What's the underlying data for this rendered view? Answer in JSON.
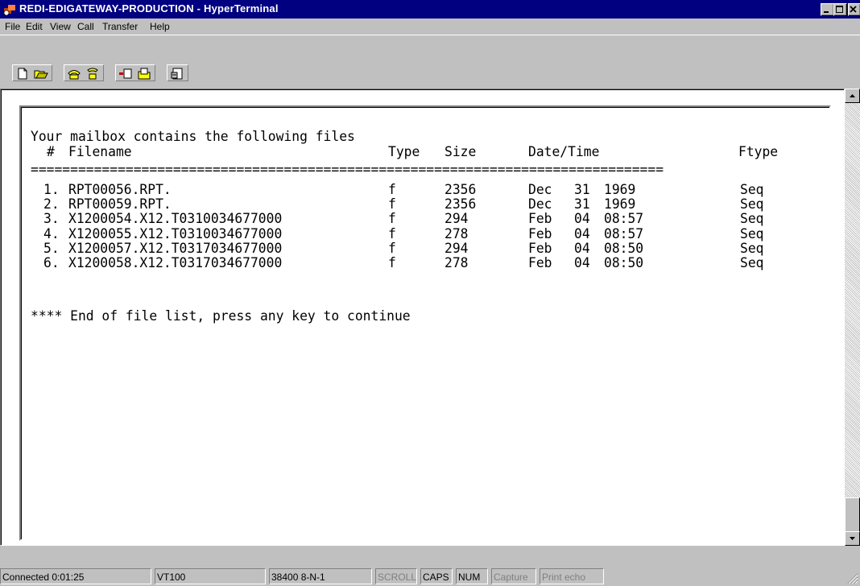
{
  "window": {
    "title": "REDI-EDIGATEWAY-PRODUCTION - HyperTerminal"
  },
  "menu": [
    "File",
    "Edit",
    "View",
    "Call",
    "Transfer",
    "Help"
  ],
  "toolbar": {
    "buttons": [
      "new-icon",
      "open-icon",
      "call-icon",
      "disconnect-icon",
      "send-icon",
      "receive-icon",
      "properties-icon"
    ]
  },
  "terminal": {
    "intro": "Your mailbox contains the following files",
    "header": {
      "num": "#",
      "filename": "Filename",
      "type": "Type",
      "size": "Size",
      "datetime": "Date/Time",
      "ftype": "Ftype"
    },
    "separator": "================================================================================",
    "files": [
      {
        "num": "1.",
        "name": "RPT00056.RPT.",
        "type": "f",
        "size": "2356",
        "mon": "Dec",
        "day": "31",
        "time": "1969",
        "ftype": "Seq"
      },
      {
        "num": "2.",
        "name": "RPT00059.RPT.",
        "type": "f",
        "size": "2356",
        "mon": "Dec",
        "day": "31",
        "time": "1969",
        "ftype": "Seq"
      },
      {
        "num": "3.",
        "name": "X1200054.X12.T0310034677000",
        "type": "f",
        "size": "294",
        "mon": "Feb",
        "day": "04",
        "time": "08:57",
        "ftype": "Seq"
      },
      {
        "num": "4.",
        "name": "X1200055.X12.T0310034677000",
        "type": "f",
        "size": "278",
        "mon": "Feb",
        "day": "04",
        "time": "08:57",
        "ftype": "Seq"
      },
      {
        "num": "5.",
        "name": "X1200057.X12.T0317034677000",
        "type": "f",
        "size": "294",
        "mon": "Feb",
        "day": "04",
        "time": "08:50",
        "ftype": "Seq"
      },
      {
        "num": "6.",
        "name": "X1200058.X12.T0317034677000",
        "type": "f",
        "size": "278",
        "mon": "Feb",
        "day": "04",
        "time": "08:50",
        "ftype": "Seq"
      }
    ],
    "footer": "**** End of file list, press any key to continue"
  },
  "status": {
    "connected": "Connected 0:01:25",
    "emulation": "VT100",
    "port": "38400 8-N-1",
    "scroll": "SCROLL",
    "caps": "CAPS",
    "num": "NUM",
    "capture": "Capture",
    "print_echo": "Print echo"
  }
}
